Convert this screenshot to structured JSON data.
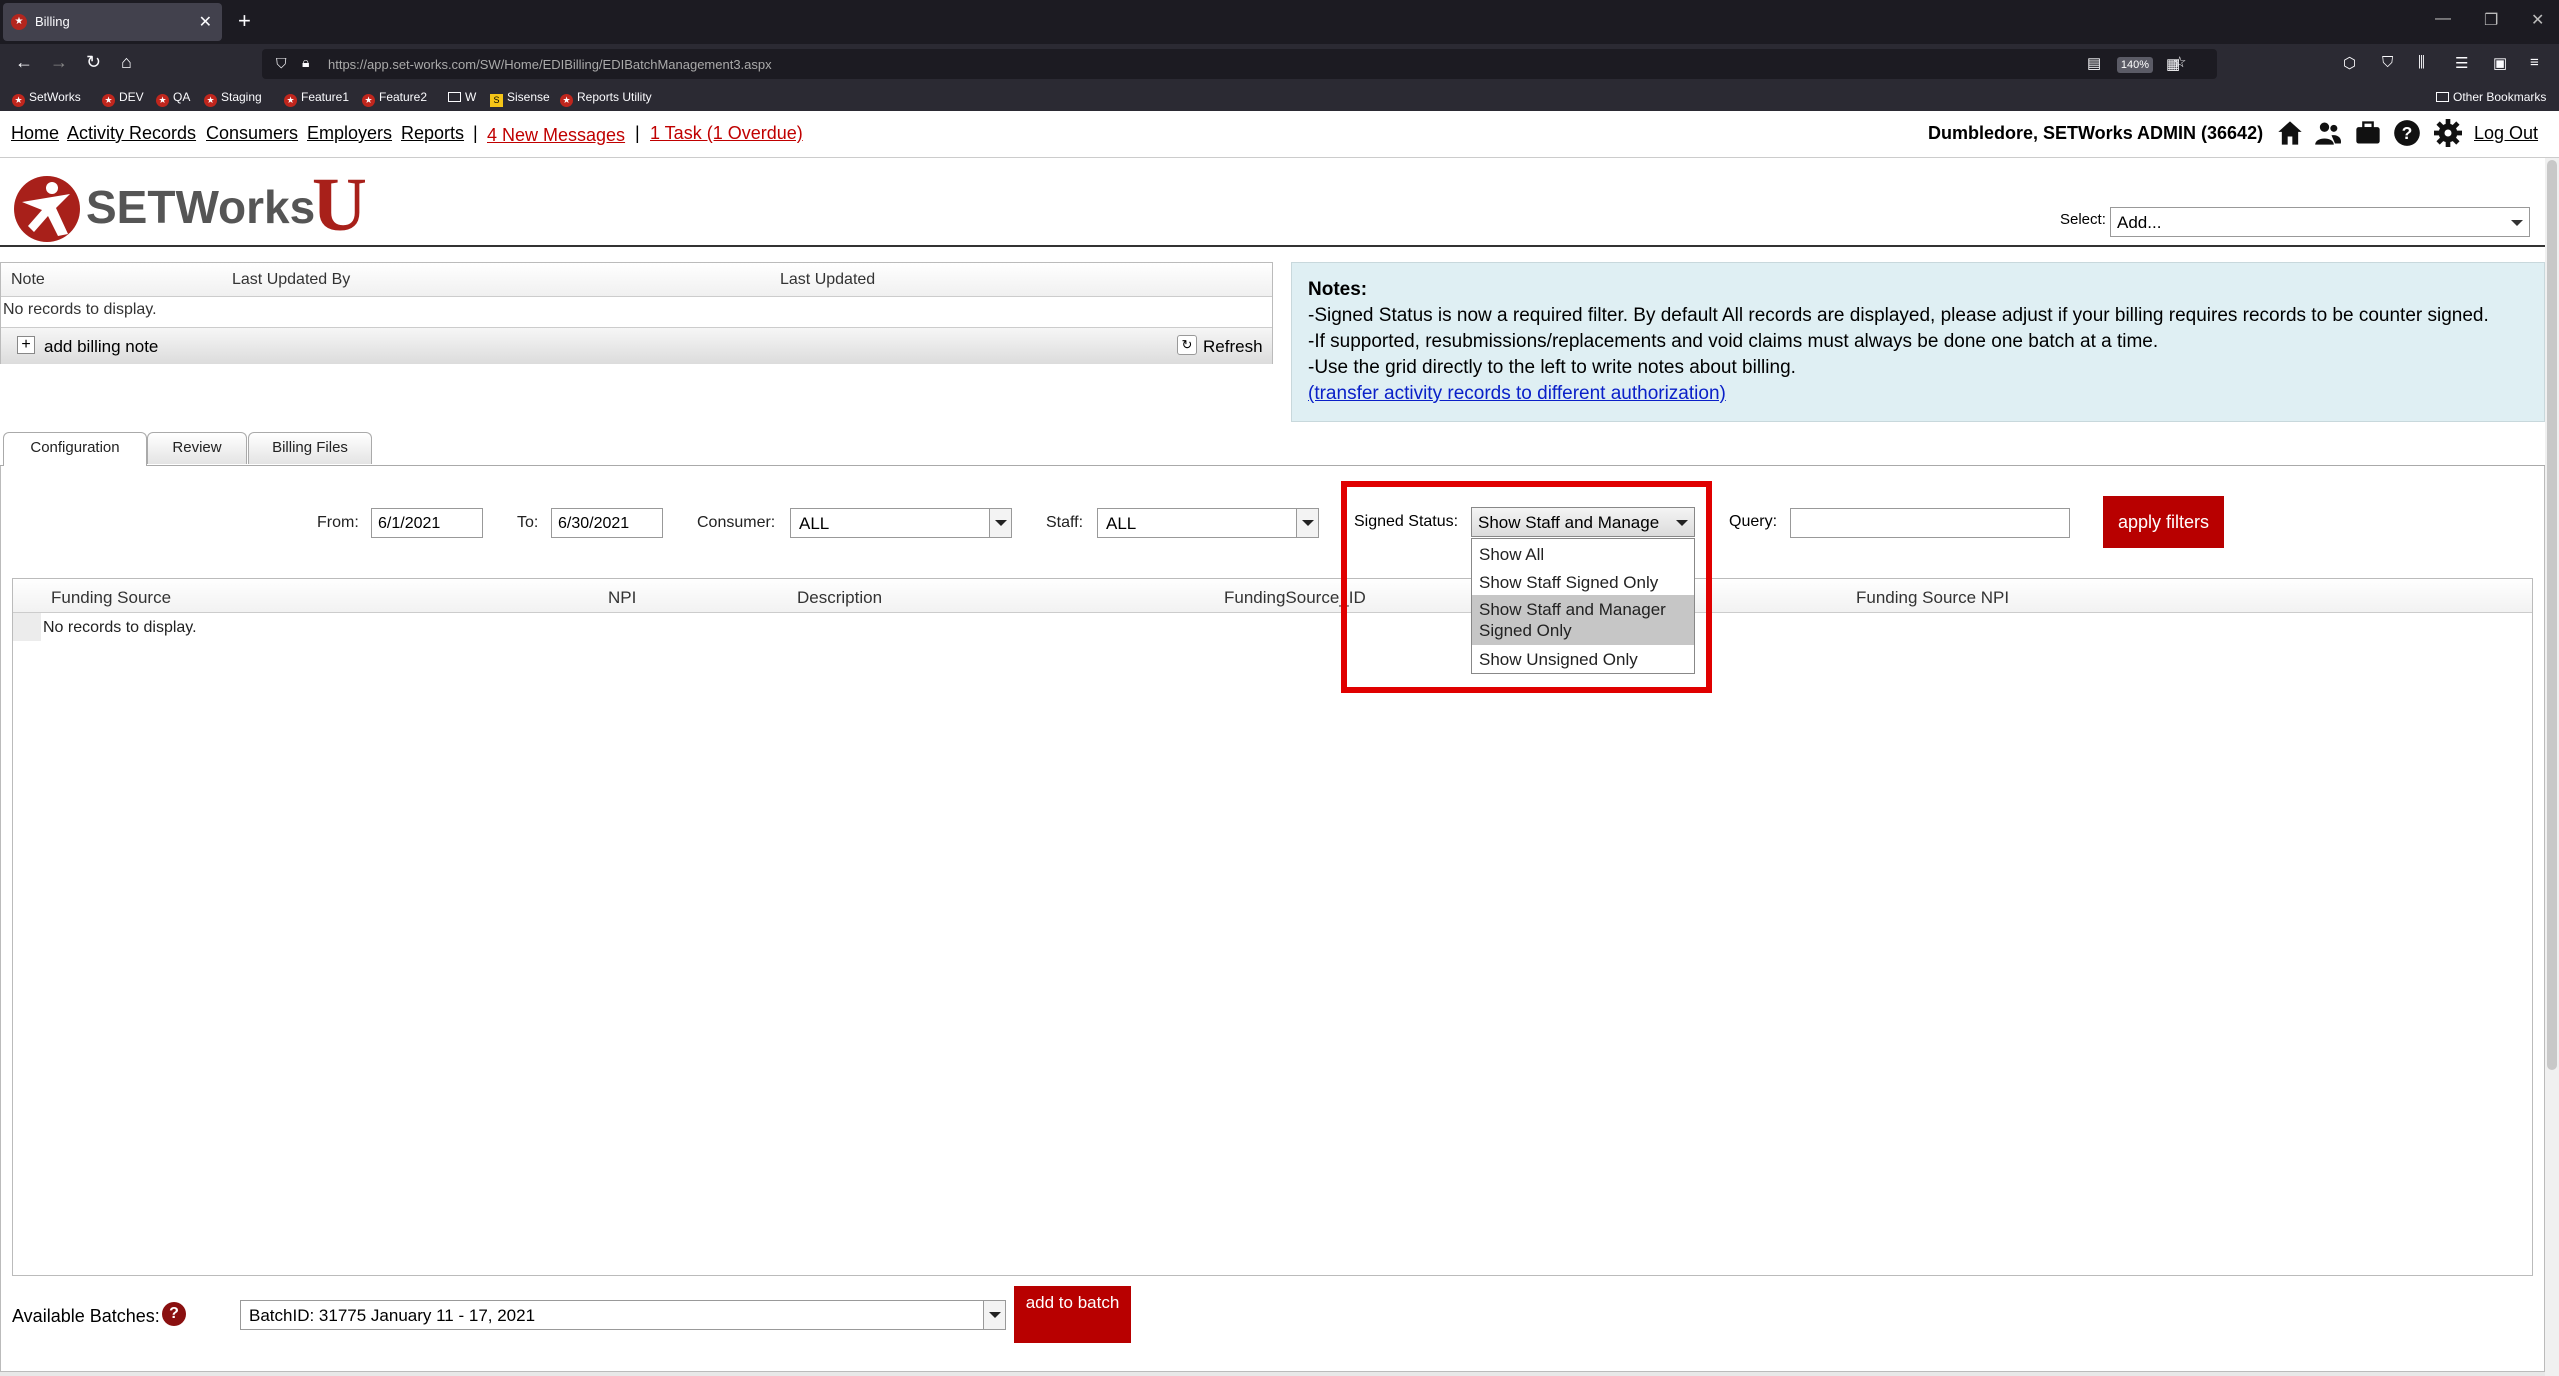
{
  "browser": {
    "tab_title": "Billing",
    "url": "https://app.set-works.com/SW/Home/EDIBilling/EDIBatchManagement3.aspx",
    "zoom": "140%",
    "bookmarks": [
      "SetWorks",
      "DEV",
      "QA",
      "Staging",
      "Feature1",
      "Feature2",
      "W",
      "Sisense",
      "Reports Utility"
    ],
    "other_bookmarks": "Other Bookmarks"
  },
  "nav": {
    "home": "Home",
    "activity": "Activity Records",
    "consumers": "Consumers",
    "employers": "Employers",
    "reports": "Reports",
    "sep": "|",
    "messages": "4 New Messages",
    "tasks": "1 Task (1 Overdue)",
    "user": "Dumbledore, SETWorks ADMIN  (36642)",
    "logout": "Log Out"
  },
  "logo": {
    "text": "SETWorks",
    "letter": "U",
    "brand_color": "#a8201a"
  },
  "select": {
    "label": "Select:",
    "value": "Add..."
  },
  "notes_grid": {
    "columns": [
      "Note",
      "Last Updated By",
      "Last Updated"
    ],
    "empty": "No records to display.",
    "add_label": "add billing note",
    "refresh_label": "Refresh"
  },
  "notes_box": {
    "title": "Notes:",
    "lines": [
      "-Signed Status is now a required filter. By default All records are displayed, please adjust if your billing requires records to be counter signed.",
      "-If supported, resubmissions/replacements and void claims must always be done one batch at a time.",
      "-Use the grid directly to the left to write notes about billing."
    ],
    "link": "(transfer activity records to different authorization)"
  },
  "tabs": [
    "Configuration",
    "Review",
    "Billing Files"
  ],
  "filters": {
    "from_label": "From:",
    "from_value": "6/1/2021",
    "to_label": "To:",
    "to_value": "6/30/2021",
    "consumer_label": "Consumer:",
    "consumer_value": "ALL",
    "staff_label": "Staff:",
    "staff_value": "ALL",
    "signed_label": "Signed Status:",
    "signed_value": "Show Staff and Manage",
    "signed_options": [
      "Show All",
      "Show Staff Signed Only",
      "Show Staff and Manager Signed Only",
      "Show Unsigned Only"
    ],
    "signed_selected_index": 2,
    "query_label": "Query:",
    "query_value": "",
    "apply_label": "apply filters"
  },
  "grid": {
    "columns": [
      "Funding Source",
      "NPI",
      "Description",
      "FundingSource_ID",
      "Funding Source NPI"
    ],
    "empty": "No records to display."
  },
  "batches": {
    "label": "Available Batches:",
    "value": "BatchID: 31775 January 11 - 17, 2021",
    "add_label": "add to batch",
    "help": "?"
  },
  "colors": {
    "accent_red": "#b80000",
    "highlight_red": "#e00000",
    "notes_bg": "#dfeff3",
    "link_blue": "#0a20c8"
  }
}
